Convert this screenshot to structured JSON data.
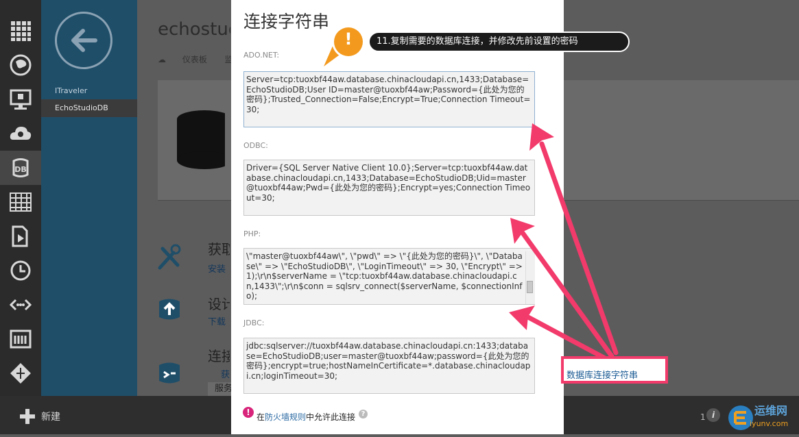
{
  "main": {
    "title": "echostudio",
    "dashboard_tab": "仪表板",
    "dashboard_tab_cut": "监",
    "sections": [
      {
        "title": "获取",
        "link": "安装"
      },
      {
        "title": "设计",
        "link": "下载"
      },
      {
        "title": "连接",
        "link": "获"
      }
    ],
    "footer_row": "服务"
  },
  "nav": {
    "items": [
      {
        "label": "ITraveler"
      },
      {
        "label": "EchoStudioDB"
      }
    ]
  },
  "rail": {
    "icons": [
      "all-items-icon",
      "websites-icon",
      "virtual-machines-icon",
      "cloud-services-icon",
      "sql-database-icon",
      "storage-icon",
      "media-services-icon",
      "service-bus-icon",
      "network-icon",
      "store-icon",
      "settings-icon"
    ]
  },
  "bottom": {
    "new_label": "新建",
    "page": "1"
  },
  "dialog": {
    "title": "连接字符串",
    "adonet_label": "ADO.NET:",
    "adonet": "Server=tcp:tuoxbf44aw.database.chinacloudapi.cn,1433;Database=EchoStudioDB;User ID=master@tuoxbf44aw;Password={此处为您的密码};Trusted_Connection=False;Encrypt=True;Connection Timeout=30;",
    "odbc_label": "ODBC:",
    "odbc": "Driver={SQL Server Native Client 10.0};Server=tcp:tuoxbf44aw.database.chinacloudapi.cn,1433;Database=EchoStudioDB;Uid=master@tuoxbf44aw;Pwd={此处为您的密码};Encrypt=yes;Connection Timeout=30;",
    "php_label": "PHP:",
    "php": "\\\"master@tuoxbf44aw\\\", \\\"pwd\\\" => \\\"{此处为您的密码}\\\", \\\"Database\\\" => \\\"EchoStudioDB\\\", \\\"LoginTimeout\\\" => 30, \\\"Encrypt\\\" => 1);\\r\\n$serverName = \\\"tcp:tuoxbf44aw.database.chinacloudapi.cn,1433\\\";\\r\\n$conn = sqlsrv_connect($serverName, $connectionInfo);",
    "jdbc_label": "JDBC:",
    "jdbc": "jdbc:sqlserver://tuoxbf44aw.database.chinacloudapi.cn:1433;database=EchoStudioDB;user=master@tuoxbf44aw;password={此处为您的密码};encrypt=true;hostNameInCertificate=*.database.chinacloudapi.cn;loginTimeout=30;",
    "firewall_prefix": "在",
    "firewall_link": "防火墙规则",
    "firewall_suffix": "中允许此连接"
  },
  "callout": {
    "text": "11.复制需要的数据库连接，并修改先前设置的密码",
    "badge": "!"
  },
  "annotation": {
    "text": "数据库连接字符串"
  },
  "watermark": {
    "name": "运维网",
    "url": "iyunv.com"
  },
  "colors": {
    "accent_pink": "#f23a6b",
    "nav_blue": "#1f4e69",
    "callout_orange": "#f39a1e",
    "link_blue": "#2b6aa3"
  }
}
